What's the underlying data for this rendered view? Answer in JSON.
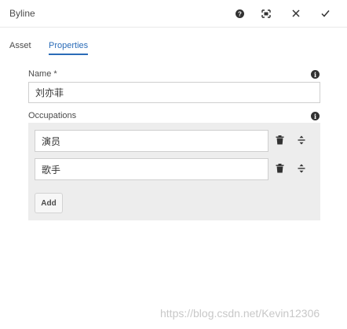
{
  "dialog": {
    "title": "Byline",
    "header_icons": [
      "help-icon",
      "fullscreen-icon",
      "close-icon",
      "check-icon"
    ]
  },
  "tabs": [
    {
      "label": "Asset"
    },
    {
      "label": "Properties"
    }
  ],
  "form": {
    "name_label": "Name *",
    "name_value": "刘亦菲",
    "occupations_label": "Occupations",
    "occupations": [
      {
        "value": "演员"
      },
      {
        "value": "歌手"
      }
    ],
    "add_label": "Add"
  },
  "watermark": "https://blog.csdn.net/Kevin12306"
}
